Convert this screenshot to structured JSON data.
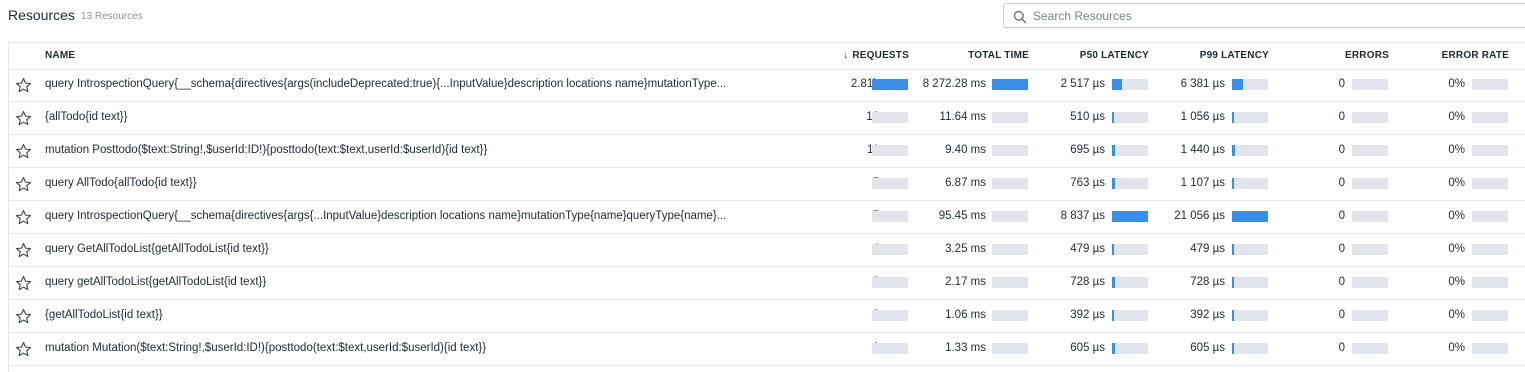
{
  "header": {
    "title": "Resources",
    "count": "13 Resources"
  },
  "search": {
    "placeholder": "Search Resources",
    "icon": "search-icon"
  },
  "columns": {
    "name": "NAME",
    "requests": "REQUESTS",
    "requests_sort": "↓",
    "total_time": "TOTAL TIME",
    "p50": "P50 LATENCY",
    "p99": "P99 LATENCY",
    "errors": "ERRORS",
    "error_rate": "ERROR RATE"
  },
  "colors": {
    "bar_fill": "#3a8ee6",
    "bar_track": "#e1e4ea"
  },
  "rows": [
    {
      "name": "query IntrospectionQuery{__schema{directives{args(includeDeprecated:true){...InputValue}description locations name}mutationType...",
      "requests": "2.81k",
      "requests_pct": 1.0,
      "total_time": "8 272.28 ms",
      "total_time_pct": 1.0,
      "p50": "2 517 µs",
      "p50_pct": 0.28,
      "p99": "6 381 µs",
      "p99_pct": 0.3,
      "errors": "0",
      "errors_pct": 0,
      "error_rate": "0%",
      "error_rate_pct": 0
    },
    {
      "name": "{allTodo{id text}}",
      "requests": "19",
      "requests_pct": 0,
      "total_time": "11.64 ms",
      "total_time_pct": 0,
      "p50": "510 µs",
      "p50_pct": 0.06,
      "p99": "1 056 µs",
      "p99_pct": 0.05,
      "errors": "0",
      "errors_pct": 0,
      "error_rate": "0%",
      "error_rate_pct": 0
    },
    {
      "name": "mutation Posttodo($text:String!,$userId:ID!){posttodo(text:$text,userId:$userId){id text}}",
      "requests": "11",
      "requests_pct": 0,
      "total_time": "9.40 ms",
      "total_time_pct": 0,
      "p50": "695 µs",
      "p50_pct": 0.08,
      "p99": "1 440 µs",
      "p99_pct": 0.07,
      "errors": "0",
      "errors_pct": 0,
      "error_rate": "0%",
      "error_rate_pct": 0
    },
    {
      "name": "query AllTodo{allTodo{id text}}",
      "requests": "7",
      "requests_pct": 0,
      "total_time": "6.87 ms",
      "total_time_pct": 0,
      "p50": "763 µs",
      "p50_pct": 0.09,
      "p99": "1 107 µs",
      "p99_pct": 0.05,
      "errors": "0",
      "errors_pct": 0,
      "error_rate": "0%",
      "error_rate_pct": 0
    },
    {
      "name": "query IntrospectionQuery{__schema{directives{args{...InputValue}description locations name}mutationType{name}queryType{name}...",
      "requests": "7",
      "requests_pct": 0,
      "total_time": "95.45 ms",
      "total_time_pct": 0,
      "p50": "8 837 µs",
      "p50_pct": 1.0,
      "p99": "21 056 µs",
      "p99_pct": 1.0,
      "errors": "0",
      "errors_pct": 0,
      "error_rate": "0%",
      "error_rate_pct": 0
    },
    {
      "name": "query GetAllTodoList{getAllTodoList{id text}}",
      "requests": "4",
      "requests_pct": 0,
      "total_time": "3.25 ms",
      "total_time_pct": 0,
      "p50": "479 µs",
      "p50_pct": 0.05,
      "p99": "479 µs",
      "p99_pct": 0.02,
      "errors": "0",
      "errors_pct": 0,
      "error_rate": "0%",
      "error_rate_pct": 0
    },
    {
      "name": "query getAllTodoList{getAllTodoList{id text}}",
      "requests": "3",
      "requests_pct": 0,
      "total_time": "2.17 ms",
      "total_time_pct": 0,
      "p50": "728 µs",
      "p50_pct": 0.08,
      "p99": "728 µs",
      "p99_pct": 0.03,
      "errors": "0",
      "errors_pct": 0,
      "error_rate": "0%",
      "error_rate_pct": 0
    },
    {
      "name": "{getAllTodoList{id text}}",
      "requests": "2",
      "requests_pct": 0,
      "total_time": "1.06 ms",
      "total_time_pct": 0,
      "p50": "392 µs",
      "p50_pct": 0.04,
      "p99": "392 µs",
      "p99_pct": 0.02,
      "errors": "0",
      "errors_pct": 0,
      "error_rate": "0%",
      "error_rate_pct": 0
    },
    {
      "name": "mutation Mutation($text:String!,$userId:ID!){posttodo(text:$text,userId:$userId){id text}}",
      "requests": "2",
      "requests_pct": 0,
      "total_time": "1.33 ms",
      "total_time_pct": 0,
      "p50": "605 µs",
      "p50_pct": 0.07,
      "p99": "605 µs",
      "p99_pct": 0.03,
      "errors": "0",
      "errors_pct": 0,
      "error_rate": "0%",
      "error_rate_pct": 0
    }
  ]
}
